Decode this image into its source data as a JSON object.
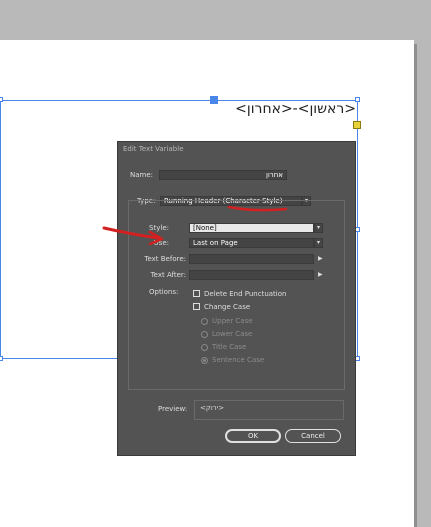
{
  "document": {
    "text_frame_content": "<ראשון>-<אחרון>"
  },
  "dialog": {
    "title": "Edit Text Variable",
    "name_label": "Name:",
    "name_value": "אחרון",
    "type_label": "Type:",
    "type_value": "Running Header (Character Style)",
    "style_label": "Style:",
    "style_value": "[None]",
    "use_label": "Use:",
    "use_value": "Last on Page",
    "text_before_label": "Text Before:",
    "text_before_value": "",
    "text_after_label": "Text After:",
    "text_after_value": "",
    "options_label": "Options:",
    "options": {
      "delete_end_punctuation": "Delete End Punctuation",
      "change_case": "Change Case",
      "upper_case": "Upper Case",
      "lower_case": "Lower Case",
      "title_case": "Title Case",
      "sentence_case": "Sentence Case"
    },
    "preview_label": "Preview:",
    "preview_value": "<ירוק>",
    "ok_label": "OK",
    "cancel_label": "Cancel"
  },
  "colors": {
    "annotation": "#d32020",
    "selection": "#4a86e8",
    "dialog_bg": "#535353"
  },
  "icons": [
    "chevron-down-icon",
    "triangle-right-icon",
    "checkbox-icon",
    "radio-icon",
    "red-arrow-annotation"
  ]
}
